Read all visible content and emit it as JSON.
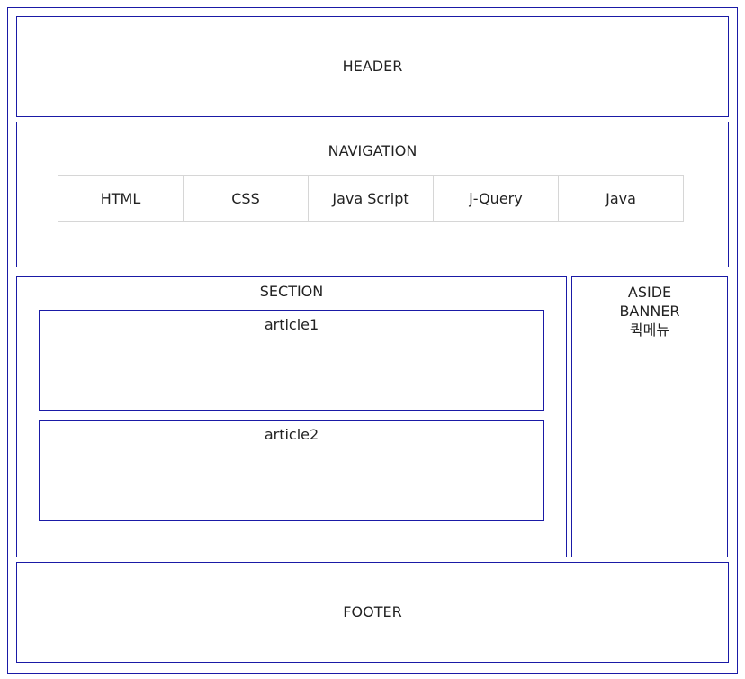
{
  "header": {
    "label": "HEADER"
  },
  "navigation": {
    "label": "NAVIGATION",
    "items": [
      {
        "label": "HTML"
      },
      {
        "label": "CSS"
      },
      {
        "label": "Java Script"
      },
      {
        "label": "j-Query"
      },
      {
        "label": "Java"
      }
    ]
  },
  "section": {
    "label": "SECTION",
    "articles": [
      {
        "label": "article1"
      },
      {
        "label": "article2"
      }
    ]
  },
  "aside": {
    "lines": [
      "ASIDE",
      "BANNER",
      "퀵메뉴"
    ]
  },
  "footer": {
    "label": "FOOTER"
  },
  "colors": {
    "border": "#1a1aa6",
    "menu_border": "#d6d6d6",
    "text": "#222222",
    "background": "#ffffff"
  }
}
